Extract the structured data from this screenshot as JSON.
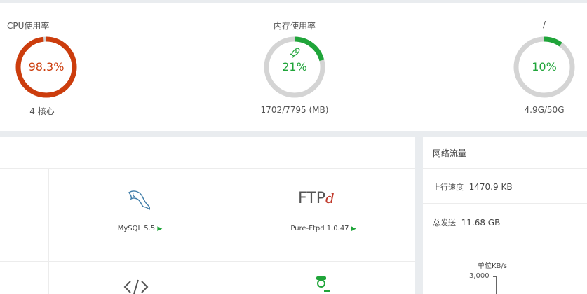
{
  "gauges": [
    {
      "title": "CPU使用率",
      "value_text": "98.3%",
      "fraction": 0.983,
      "sub": "4 核心",
      "color": "#cc3d0d"
    },
    {
      "title": "内存使用率",
      "value_text": "21%",
      "fraction": 0.21,
      "sub": "1702/7795 (MB)",
      "color": "#20a53a",
      "icon": "rocket-icon"
    },
    {
      "title": "/",
      "value_text": "10%",
      "fraction": 0.1,
      "sub": "4.9G/50G",
      "color": "#20a53a"
    }
  ],
  "software": [
    {
      "name": "MySQL 5.5",
      "icon": "dolphin-icon"
    },
    {
      "name": "Pure-Ftpd 1.0.47",
      "icon": "ftp-logo",
      "logo_text": "FTP"
    },
    {
      "icon": "code-icon"
    },
    {
      "icon": "agent-icon"
    }
  ],
  "network": {
    "title": "网络流量",
    "upload_label": "上行速度",
    "upload_value": "1470.9 KB",
    "sent_label": "总发送",
    "sent_value": "11.68 GB",
    "chart_unit": "单位KB/s",
    "chart_tick": "3,000"
  },
  "colors": {
    "ring_track": "#d4d4d4",
    "accent_green": "#20a53a",
    "danger": "#cc3d0d"
  }
}
